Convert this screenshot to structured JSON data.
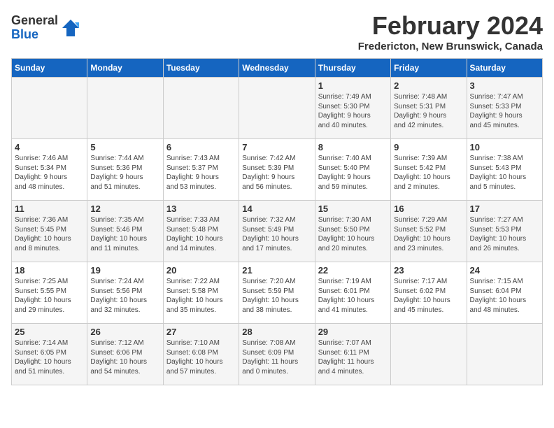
{
  "logo": {
    "general": "General",
    "blue": "Blue"
  },
  "title": "February 2024",
  "location": "Fredericton, New Brunswick, Canada",
  "days_of_week": [
    "Sunday",
    "Monday",
    "Tuesday",
    "Wednesday",
    "Thursday",
    "Friday",
    "Saturday"
  ],
  "weeks": [
    [
      {
        "day": "",
        "content": ""
      },
      {
        "day": "",
        "content": ""
      },
      {
        "day": "",
        "content": ""
      },
      {
        "day": "",
        "content": ""
      },
      {
        "day": "1",
        "content": "Sunrise: 7:49 AM\nSunset: 5:30 PM\nDaylight: 9 hours\nand 40 minutes."
      },
      {
        "day": "2",
        "content": "Sunrise: 7:48 AM\nSunset: 5:31 PM\nDaylight: 9 hours\nand 42 minutes."
      },
      {
        "day": "3",
        "content": "Sunrise: 7:47 AM\nSunset: 5:33 PM\nDaylight: 9 hours\nand 45 minutes."
      }
    ],
    [
      {
        "day": "4",
        "content": "Sunrise: 7:46 AM\nSunset: 5:34 PM\nDaylight: 9 hours\nand 48 minutes."
      },
      {
        "day": "5",
        "content": "Sunrise: 7:44 AM\nSunset: 5:36 PM\nDaylight: 9 hours\nand 51 minutes."
      },
      {
        "day": "6",
        "content": "Sunrise: 7:43 AM\nSunset: 5:37 PM\nDaylight: 9 hours\nand 53 minutes."
      },
      {
        "day": "7",
        "content": "Sunrise: 7:42 AM\nSunset: 5:39 PM\nDaylight: 9 hours\nand 56 minutes."
      },
      {
        "day": "8",
        "content": "Sunrise: 7:40 AM\nSunset: 5:40 PM\nDaylight: 9 hours\nand 59 minutes."
      },
      {
        "day": "9",
        "content": "Sunrise: 7:39 AM\nSunset: 5:42 PM\nDaylight: 10 hours\nand 2 minutes."
      },
      {
        "day": "10",
        "content": "Sunrise: 7:38 AM\nSunset: 5:43 PM\nDaylight: 10 hours\nand 5 minutes."
      }
    ],
    [
      {
        "day": "11",
        "content": "Sunrise: 7:36 AM\nSunset: 5:45 PM\nDaylight: 10 hours\nand 8 minutes."
      },
      {
        "day": "12",
        "content": "Sunrise: 7:35 AM\nSunset: 5:46 PM\nDaylight: 10 hours\nand 11 minutes."
      },
      {
        "day": "13",
        "content": "Sunrise: 7:33 AM\nSunset: 5:48 PM\nDaylight: 10 hours\nand 14 minutes."
      },
      {
        "day": "14",
        "content": "Sunrise: 7:32 AM\nSunset: 5:49 PM\nDaylight: 10 hours\nand 17 minutes."
      },
      {
        "day": "15",
        "content": "Sunrise: 7:30 AM\nSunset: 5:50 PM\nDaylight: 10 hours\nand 20 minutes."
      },
      {
        "day": "16",
        "content": "Sunrise: 7:29 AM\nSunset: 5:52 PM\nDaylight: 10 hours\nand 23 minutes."
      },
      {
        "day": "17",
        "content": "Sunrise: 7:27 AM\nSunset: 5:53 PM\nDaylight: 10 hours\nand 26 minutes."
      }
    ],
    [
      {
        "day": "18",
        "content": "Sunrise: 7:25 AM\nSunset: 5:55 PM\nDaylight: 10 hours\nand 29 minutes."
      },
      {
        "day": "19",
        "content": "Sunrise: 7:24 AM\nSunset: 5:56 PM\nDaylight: 10 hours\nand 32 minutes."
      },
      {
        "day": "20",
        "content": "Sunrise: 7:22 AM\nSunset: 5:58 PM\nDaylight: 10 hours\nand 35 minutes."
      },
      {
        "day": "21",
        "content": "Sunrise: 7:20 AM\nSunset: 5:59 PM\nDaylight: 10 hours\nand 38 minutes."
      },
      {
        "day": "22",
        "content": "Sunrise: 7:19 AM\nSunset: 6:01 PM\nDaylight: 10 hours\nand 41 minutes."
      },
      {
        "day": "23",
        "content": "Sunrise: 7:17 AM\nSunset: 6:02 PM\nDaylight: 10 hours\nand 45 minutes."
      },
      {
        "day": "24",
        "content": "Sunrise: 7:15 AM\nSunset: 6:04 PM\nDaylight: 10 hours\nand 48 minutes."
      }
    ],
    [
      {
        "day": "25",
        "content": "Sunrise: 7:14 AM\nSunset: 6:05 PM\nDaylight: 10 hours\nand 51 minutes."
      },
      {
        "day": "26",
        "content": "Sunrise: 7:12 AM\nSunset: 6:06 PM\nDaylight: 10 hours\nand 54 minutes."
      },
      {
        "day": "27",
        "content": "Sunrise: 7:10 AM\nSunset: 6:08 PM\nDaylight: 10 hours\nand 57 minutes."
      },
      {
        "day": "28",
        "content": "Sunrise: 7:08 AM\nSunset: 6:09 PM\nDaylight: 11 hours\nand 0 minutes."
      },
      {
        "day": "29",
        "content": "Sunrise: 7:07 AM\nSunset: 6:11 PM\nDaylight: 11 hours\nand 4 minutes."
      },
      {
        "day": "",
        "content": ""
      },
      {
        "day": "",
        "content": ""
      }
    ]
  ]
}
